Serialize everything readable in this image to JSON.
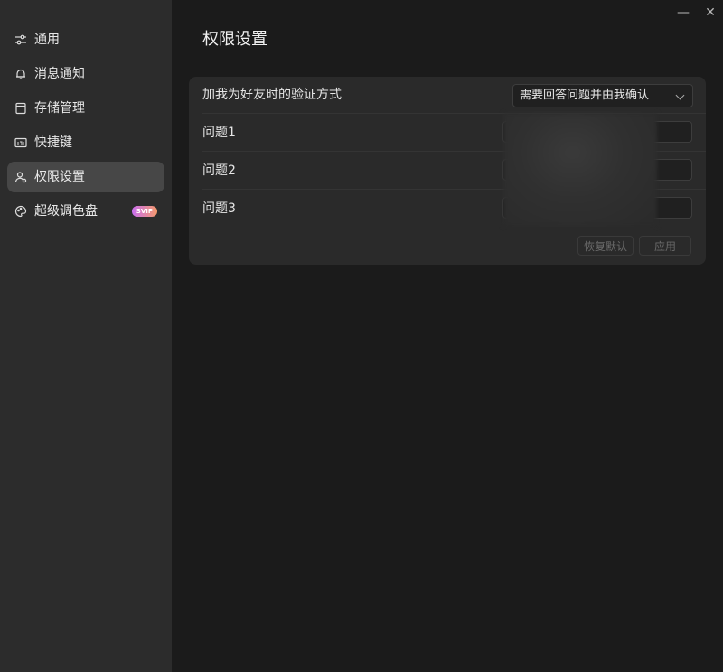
{
  "window": {
    "minimize_label": "—",
    "close_label": "✕"
  },
  "sidebar": {
    "items": [
      {
        "label": "通用",
        "icon": "sliders-icon",
        "active": false
      },
      {
        "label": "消息通知",
        "icon": "bell-icon",
        "active": false
      },
      {
        "label": "存储管理",
        "icon": "storage-icon",
        "active": false
      },
      {
        "label": "快捷键",
        "icon": "keyboard-icon",
        "active": false
      },
      {
        "label": "权限设置",
        "icon": "user-permission-icon",
        "active": true
      },
      {
        "label": "超级调色盘",
        "icon": "palette-icon",
        "active": false,
        "badge": "SVIP"
      }
    ]
  },
  "main": {
    "title": "权限设置",
    "verification": {
      "label": "加我为好友时的验证方式",
      "selected": "需要回答问题并由我确认"
    },
    "questions": [
      {
        "label": "问题1",
        "value": ""
      },
      {
        "label": "问题2",
        "value": ""
      },
      {
        "label": "问题3",
        "value": ""
      }
    ],
    "buttons": {
      "reset": "恢复默认",
      "apply": "应用"
    }
  },
  "colors": {
    "background": "#1b1b1b",
    "sidebar": "#2c2c2c",
    "sidebar_active": "#474747",
    "card": "#2a2a2a",
    "badge_gradient_start": "#c96ff0",
    "badge_gradient_end": "#f59a6a"
  }
}
